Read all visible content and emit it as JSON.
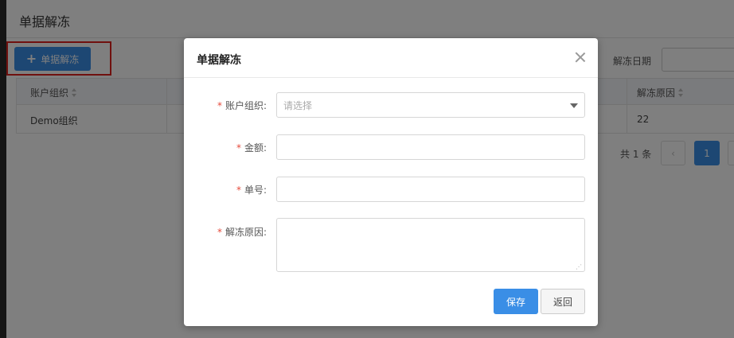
{
  "page": {
    "title": "单据解冻",
    "add_button_label": "单据解冻",
    "date_filter_label": "解冻日期"
  },
  "table": {
    "columns": [
      "账户组织",
      "解冻原因"
    ],
    "rows": [
      {
        "org": "Demo组织",
        "reason": "22"
      }
    ]
  },
  "pager": {
    "total": "共 1 条",
    "prev": "‹",
    "current_page": "1"
  },
  "modal": {
    "title": "单据解冻",
    "fields": [
      {
        "label": "账户组织:",
        "placeholder": "请选择"
      },
      {
        "label": "金额:"
      },
      {
        "label": "单号:"
      },
      {
        "label": "解冻原因:"
      }
    ],
    "required_mark": "*",
    "save_label": "保存",
    "back_label": "返回"
  },
  "colors": {
    "primary": "#3a8ee6",
    "highlight": "#e0201c",
    "required": "#e64a3b"
  }
}
